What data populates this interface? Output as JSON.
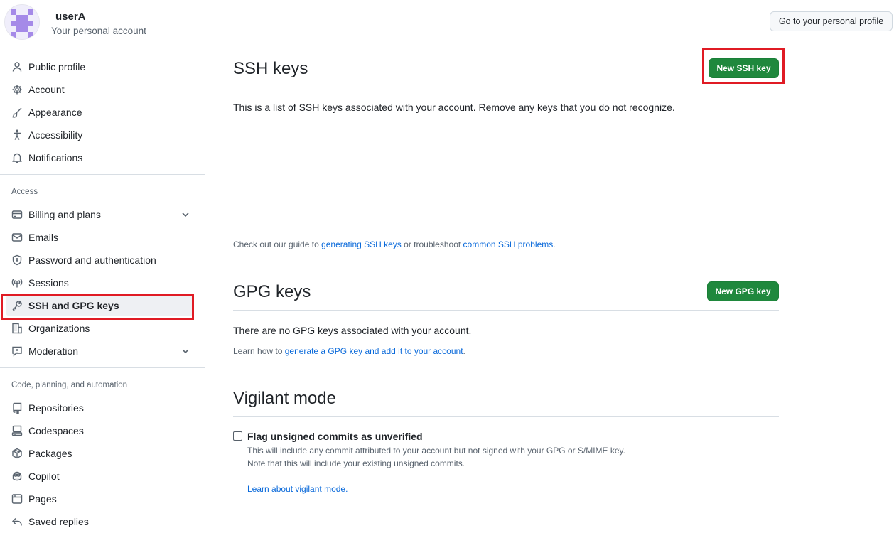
{
  "account": {
    "username": "userA",
    "subtitle": "Your personal account",
    "profile_button": "Go to your personal profile"
  },
  "sidebar": {
    "items_top": [
      {
        "label": "Public profile",
        "icon": "person-icon"
      },
      {
        "label": "Account",
        "icon": "gear-icon"
      },
      {
        "label": "Appearance",
        "icon": "paintbrush-icon"
      },
      {
        "label": "Accessibility",
        "icon": "accessibility-icon"
      },
      {
        "label": "Notifications",
        "icon": "bell-icon"
      }
    ],
    "access_heading": "Access",
    "items_access": [
      {
        "label": "Billing and plans",
        "icon": "credit-card-icon"
      },
      {
        "label": "Emails",
        "icon": "mail-icon"
      },
      {
        "label": "Password and authentication",
        "icon": "shield-icon"
      },
      {
        "label": "Sessions",
        "icon": "broadcast-icon"
      },
      {
        "label": "SSH and GPG keys",
        "icon": "key-icon"
      },
      {
        "label": "Organizations",
        "icon": "organization-icon"
      },
      {
        "label": "Moderation",
        "icon": "report-icon"
      }
    ],
    "code_heading": "Code, planning, and automation",
    "items_code": [
      {
        "label": "Repositories",
        "icon": "repo-icon"
      },
      {
        "label": "Codespaces",
        "icon": "codespaces-icon"
      },
      {
        "label": "Packages",
        "icon": "package-icon"
      },
      {
        "label": "Copilot",
        "icon": "copilot-icon"
      },
      {
        "label": "Pages",
        "icon": "browser-icon"
      },
      {
        "label": "Saved replies",
        "icon": "reply-icon"
      }
    ]
  },
  "ssh": {
    "title": "SSH keys",
    "button": "New SSH key",
    "description": "This is a list of SSH keys associated with your account. Remove any keys that you do not recognize.",
    "guide_prefix": "Check out our guide to ",
    "guide_link1": "generating SSH keys",
    "guide_middle": " or troubleshoot ",
    "guide_link2": "common SSH problems",
    "guide_suffix": "."
  },
  "gpg": {
    "title": "GPG keys",
    "button": "New GPG key",
    "description": "There are no GPG keys associated with your account.",
    "learn_prefix": "Learn how to ",
    "learn_link": "generate a GPG key and add it to your account",
    "learn_suffix": "."
  },
  "vigilant": {
    "title": "Vigilant mode",
    "checkbox_label": "Flag unsigned commits as unverified",
    "line1": "This will include any commit attributed to your account but not signed with your GPG or S/MIME key.",
    "line2": "Note that this will include your existing unsigned commits.",
    "link": "Learn about vigilant mode."
  },
  "colors": {
    "primary_button": "#1f883d",
    "link": "#0969da",
    "highlight_box": "#e01b24"
  }
}
